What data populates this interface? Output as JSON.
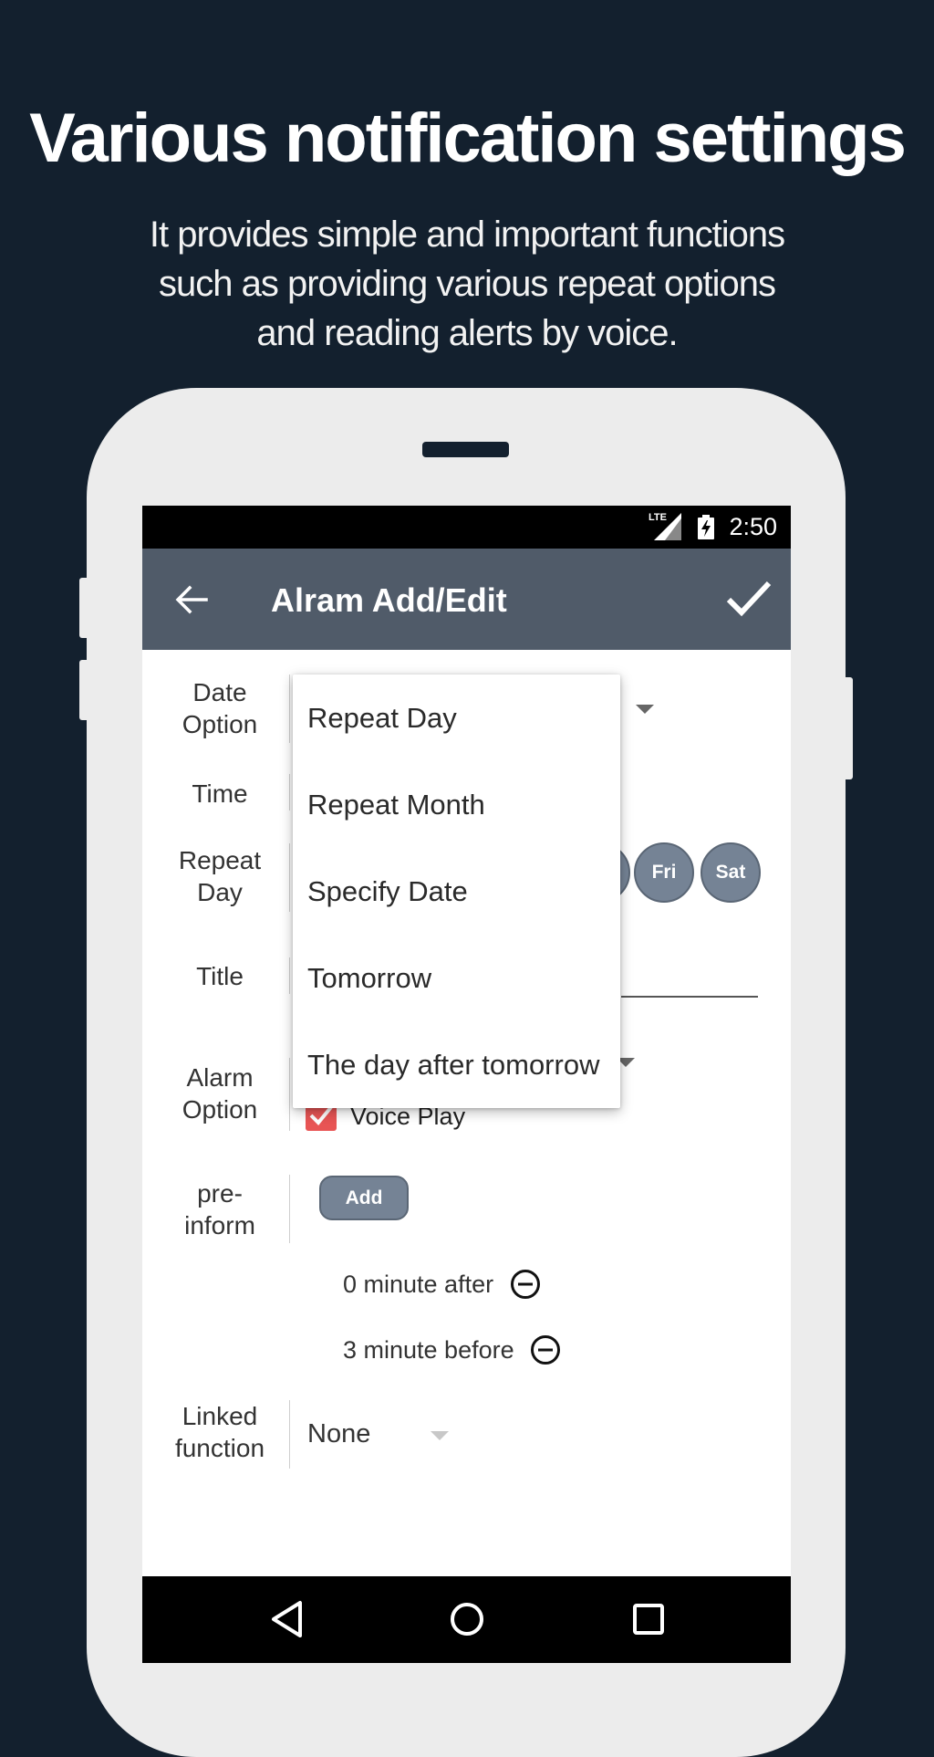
{
  "headline": "Various notification settings",
  "subline": [
    "It provides simple and important functions",
    "such as providing various repeat options",
    "and reading alerts by voice."
  ],
  "status": {
    "network": "LTE",
    "time": "2:50"
  },
  "appbar": {
    "title": "Alram Add/Edit",
    "back_icon": "arrow-left-icon",
    "confirm_icon": "checkmark-icon"
  },
  "labels": {
    "date_option": [
      "Date",
      "Option"
    ],
    "time": "Time",
    "repeat_day": [
      "Repeat",
      "Day"
    ],
    "title": "Title",
    "alarm_option": [
      "Alarm",
      "Option"
    ],
    "pre_inform": [
      "pre-",
      "inform"
    ],
    "linked_function": [
      "Linked",
      "function"
    ]
  },
  "repeat_days": [
    "Fri",
    "Sat"
  ],
  "alarm_option": {
    "voice_play_label": "Voice Play",
    "voice_play_checked": true
  },
  "pre_inform": {
    "add_label": "Add",
    "items": [
      "0 minute after",
      "3 minute before"
    ]
  },
  "linked_function": {
    "value": "None"
  },
  "dropdown": {
    "items": [
      "Repeat Day",
      "Repeat Month",
      "Specify Date",
      "Tomorrow",
      "The day after tomorrow"
    ]
  },
  "colors": {
    "background": "#13202e",
    "appbar": "#505b69",
    "day_circle": "#758395",
    "checkbox": "#e85454"
  }
}
